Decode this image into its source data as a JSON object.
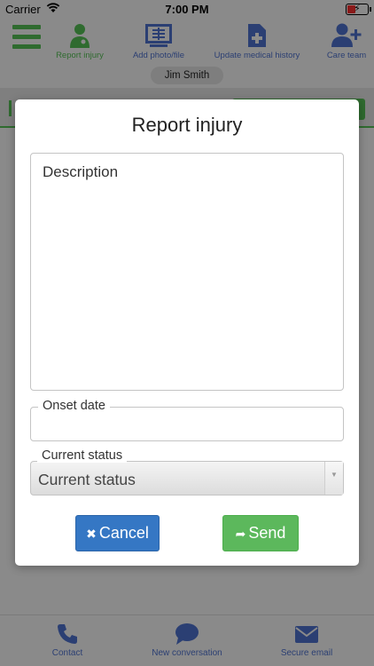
{
  "status_bar": {
    "carrier": "Carrier",
    "time": "7:00 PM"
  },
  "toolbar": {
    "items": [
      {
        "label": "Report injury",
        "icon": "doctor-icon"
      },
      {
        "label": "Add photo/file",
        "icon": "xray-icon"
      },
      {
        "label": "Update medical history",
        "icon": "medical-file-icon"
      },
      {
        "label": "Care team",
        "icon": "add-user-icon"
      }
    ]
  },
  "patient": {
    "name": "Jim Smith"
  },
  "modal": {
    "title": "Report injury",
    "description_placeholder": "Description",
    "onset_label": "Onset date",
    "onset_value": "",
    "status_label": "Current status",
    "status_value": "Current status",
    "cancel_label": "Cancel",
    "send_label": "Send"
  },
  "bottom_bar": {
    "items": [
      {
        "label": "Contact",
        "icon": "phone-icon"
      },
      {
        "label": "New conversation",
        "icon": "chat-bubble-icon"
      },
      {
        "label": "Secure email",
        "icon": "envelope-icon"
      }
    ]
  },
  "colors": {
    "green": "#2f6b2f",
    "navy": "#2b3f73",
    "cancel_blue": "#3577c4",
    "send_green": "#5cb85c"
  }
}
